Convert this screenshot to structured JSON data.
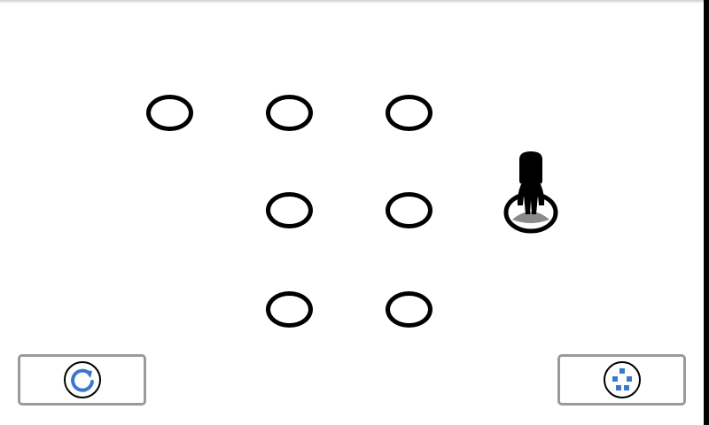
{
  "game": {
    "board": {
      "holes": [
        {
          "row": 0,
          "col": 0
        },
        {
          "row": 0,
          "col": 1
        },
        {
          "row": 0,
          "col": 2
        },
        {
          "row": 1,
          "col": 1
        },
        {
          "row": 1,
          "col": 2
        },
        {
          "row": 2,
          "col": 1
        },
        {
          "row": 2,
          "col": 2
        }
      ],
      "player": {
        "row": 1,
        "col": 3
      }
    },
    "colors": {
      "hole_outline": "#000000",
      "button_border": "#9a9a9a",
      "icon_blue": "#3a79c9",
      "player_figure": "#000000",
      "player_base": "#8a8a8a"
    },
    "buttons": {
      "restart_icon": "restart-arrow-icon",
      "solve_icon": "dots-grid-icon"
    }
  }
}
